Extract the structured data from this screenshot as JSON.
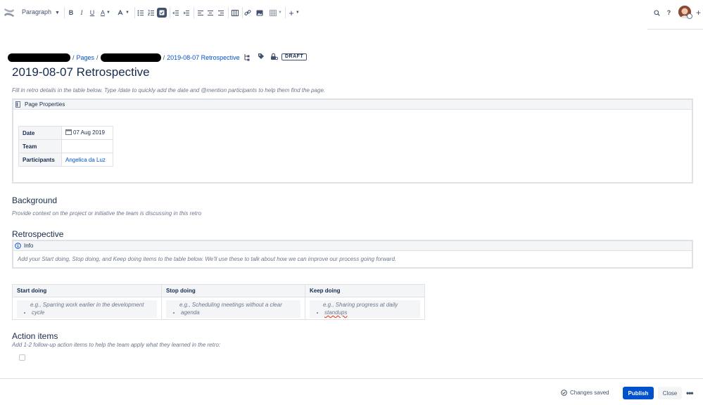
{
  "toolbar": {
    "paragraph_label": "Paragraph",
    "icons": [
      "confluence-logo-icon",
      "bold-icon",
      "italic-icon",
      "underline-icon",
      "text-color-icon",
      "text-style-icon",
      "bullet-list-icon",
      "numbered-list-icon",
      "task-list-icon",
      "outdent-icon",
      "indent-icon",
      "align-left-icon",
      "align-center-icon",
      "align-right-icon",
      "layout-icon",
      "link-icon",
      "image-icon",
      "table-icon",
      "insert-more-icon",
      "search-icon",
      "help-icon",
      "avatar"
    ],
    "bold": "B",
    "italic": "I",
    "underline": "U",
    "text_color": "A",
    "help": "?",
    "plus": "+"
  },
  "breadcrumb": {
    "pages_label": "Pages",
    "current": "2019-08-07 Retrospective",
    "status": "DRAFT"
  },
  "page": {
    "title": "2019-08-07 Retrospective",
    "instructions": "Fill in retro details in the table below. Type /date to quickly add the date and @mention participants to help them find the page."
  },
  "page_properties": {
    "header": "Page Properties",
    "rows": [
      {
        "key": "Date",
        "value": "07 Aug 2019"
      },
      {
        "key": "Team",
        "value": ""
      },
      {
        "key": "Participants",
        "value": "Angelica da Luz"
      }
    ]
  },
  "background": {
    "heading": "Background",
    "hint": "Provide context on the project or initiative the team is discussing in this retro"
  },
  "retrospective": {
    "heading": "Retrospective",
    "info_title": "Info",
    "info_body": "Add your Start doing, Stop doing, and Keep doing items to the table below. We'll use these to talk about how we can improve our process going forward.",
    "columns": [
      "Start doing",
      "Stop doing",
      "Keep doing"
    ],
    "cells": [
      {
        "line1": "e.g., Sparring work earlier in the development",
        "line2": "cycle"
      },
      {
        "line1": "e.g., Scheduling meetings without a clear",
        "line2": "agenda"
      },
      {
        "line1": "e.g., Sharing progress at daily",
        "line2": "standups"
      }
    ]
  },
  "action_items": {
    "heading": "Action items",
    "hint": "Add 1-2 follow-up action items to help the team apply what they learned in the retro:"
  },
  "footer": {
    "saved_label": "Changes saved",
    "publish_label": "Publish",
    "close_label": "Close",
    "more_label": "•••"
  },
  "colors": {
    "primary": "#0052cc",
    "text": "#172b4d",
    "subtle": "#6b778c",
    "border": "#dfe1e6",
    "panel": "#f4f5f7"
  }
}
